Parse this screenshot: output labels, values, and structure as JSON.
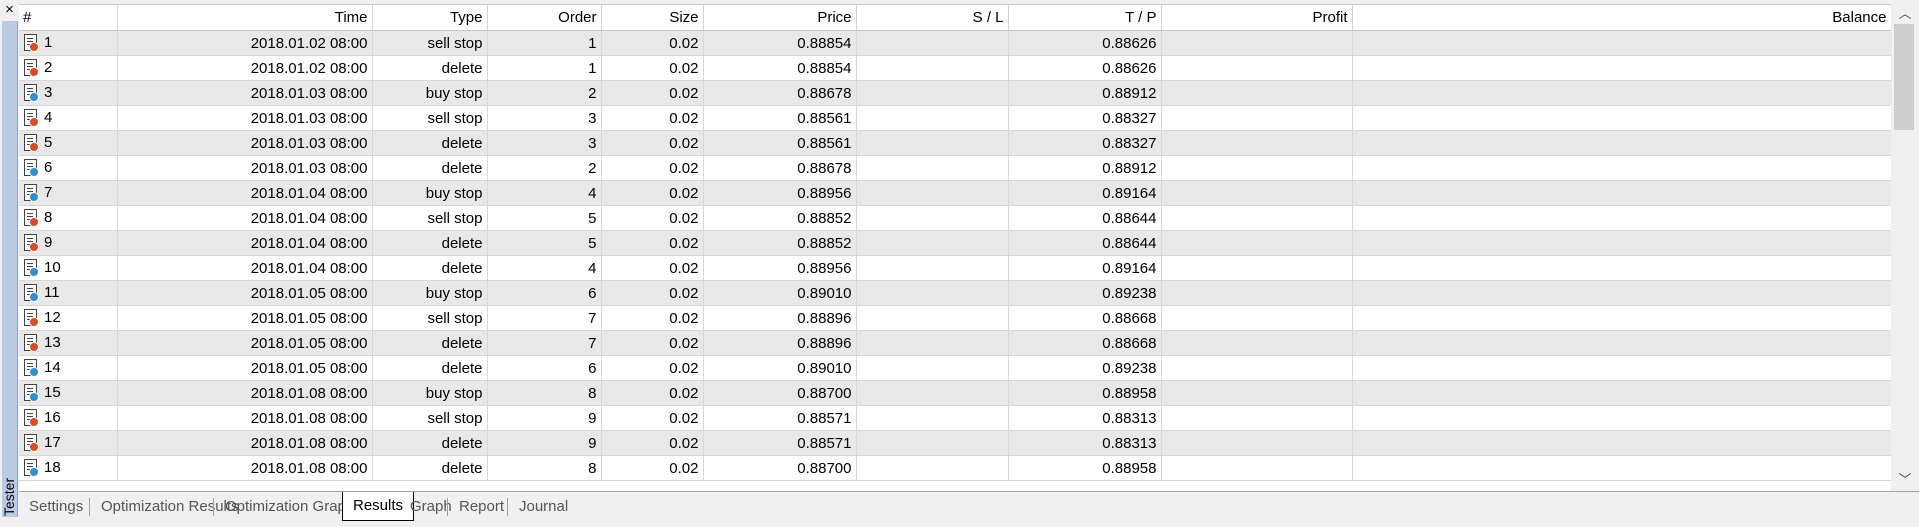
{
  "panel": {
    "side_label": "Tester",
    "close_label": "×"
  },
  "columns": [
    "#",
    "Time",
    "Type",
    "Order",
    "Size",
    "Price",
    "S / L",
    "T / P",
    "Profit",
    "Balance"
  ],
  "rows": [
    {
      "id": "1",
      "time": "2018.01.02 08:00",
      "type": "sell stop",
      "order": "1",
      "size": "0.02",
      "price": "0.88854",
      "sl": "",
      "tp": "0.88626",
      "profit": "",
      "balance": "",
      "dot": "sell"
    },
    {
      "id": "2",
      "time": "2018.01.02 08:00",
      "type": "delete",
      "order": "1",
      "size": "0.02",
      "price": "0.88854",
      "sl": "",
      "tp": "0.88626",
      "profit": "",
      "balance": "",
      "dot": "sell"
    },
    {
      "id": "3",
      "time": "2018.01.03 08:00",
      "type": "buy stop",
      "order": "2",
      "size": "0.02",
      "price": "0.88678",
      "sl": "",
      "tp": "0.88912",
      "profit": "",
      "balance": "",
      "dot": "buy"
    },
    {
      "id": "4",
      "time": "2018.01.03 08:00",
      "type": "sell stop",
      "order": "3",
      "size": "0.02",
      "price": "0.88561",
      "sl": "",
      "tp": "0.88327",
      "profit": "",
      "balance": "",
      "dot": "sell"
    },
    {
      "id": "5",
      "time": "2018.01.03 08:00",
      "type": "delete",
      "order": "3",
      "size": "0.02",
      "price": "0.88561",
      "sl": "",
      "tp": "0.88327",
      "profit": "",
      "balance": "",
      "dot": "sell"
    },
    {
      "id": "6",
      "time": "2018.01.03 08:00",
      "type": "delete",
      "order": "2",
      "size": "0.02",
      "price": "0.88678",
      "sl": "",
      "tp": "0.88912",
      "profit": "",
      "balance": "",
      "dot": "buy"
    },
    {
      "id": "7",
      "time": "2018.01.04 08:00",
      "type": "buy stop",
      "order": "4",
      "size": "0.02",
      "price": "0.88956",
      "sl": "",
      "tp": "0.89164",
      "profit": "",
      "balance": "",
      "dot": "buy"
    },
    {
      "id": "8",
      "time": "2018.01.04 08:00",
      "type": "sell stop",
      "order": "5",
      "size": "0.02",
      "price": "0.88852",
      "sl": "",
      "tp": "0.88644",
      "profit": "",
      "balance": "",
      "dot": "sell"
    },
    {
      "id": "9",
      "time": "2018.01.04 08:00",
      "type": "delete",
      "order": "5",
      "size": "0.02",
      "price": "0.88852",
      "sl": "",
      "tp": "0.88644",
      "profit": "",
      "balance": "",
      "dot": "sell"
    },
    {
      "id": "10",
      "time": "2018.01.04 08:00",
      "type": "delete",
      "order": "4",
      "size": "0.02",
      "price": "0.88956",
      "sl": "",
      "tp": "0.89164",
      "profit": "",
      "balance": "",
      "dot": "buy"
    },
    {
      "id": "11",
      "time": "2018.01.05 08:00",
      "type": "buy stop",
      "order": "6",
      "size": "0.02",
      "price": "0.89010",
      "sl": "",
      "tp": "0.89238",
      "profit": "",
      "balance": "",
      "dot": "buy"
    },
    {
      "id": "12",
      "time": "2018.01.05 08:00",
      "type": "sell stop",
      "order": "7",
      "size": "0.02",
      "price": "0.88896",
      "sl": "",
      "tp": "0.88668",
      "profit": "",
      "balance": "",
      "dot": "sell"
    },
    {
      "id": "13",
      "time": "2018.01.05 08:00",
      "type": "delete",
      "order": "7",
      "size": "0.02",
      "price": "0.88896",
      "sl": "",
      "tp": "0.88668",
      "profit": "",
      "balance": "",
      "dot": "sell"
    },
    {
      "id": "14",
      "time": "2018.01.05 08:00",
      "type": "delete",
      "order": "6",
      "size": "0.02",
      "price": "0.89010",
      "sl": "",
      "tp": "0.89238",
      "profit": "",
      "balance": "",
      "dot": "buy"
    },
    {
      "id": "15",
      "time": "2018.01.08 08:00",
      "type": "buy stop",
      "order": "8",
      "size": "0.02",
      "price": "0.88700",
      "sl": "",
      "tp": "0.88958",
      "profit": "",
      "balance": "",
      "dot": "buy"
    },
    {
      "id": "16",
      "time": "2018.01.08 08:00",
      "type": "sell stop",
      "order": "9",
      "size": "0.02",
      "price": "0.88571",
      "sl": "",
      "tp": "0.88313",
      "profit": "",
      "balance": "",
      "dot": "sell"
    },
    {
      "id": "17",
      "time": "2018.01.08 08:00",
      "type": "delete",
      "order": "9",
      "size": "0.02",
      "price": "0.88571",
      "sl": "",
      "tp": "0.88313",
      "profit": "",
      "balance": "",
      "dot": "sell"
    },
    {
      "id": "18",
      "time": "2018.01.08 08:00",
      "type": "delete",
      "order": "8",
      "size": "0.02",
      "price": "0.88700",
      "sl": "",
      "tp": "0.88958",
      "profit": "",
      "balance": "",
      "dot": "buy"
    }
  ],
  "tabs": [
    {
      "label": "Settings",
      "active": false
    },
    {
      "label": "Optimization Results",
      "active": false
    },
    {
      "label": "Optimization Graph",
      "active": false
    },
    {
      "label": "Results",
      "active": true
    },
    {
      "label": "Graph",
      "active": false
    },
    {
      "label": "Report",
      "active": false
    },
    {
      "label": "Journal",
      "active": false
    }
  ],
  "icons": {
    "row_icon": "order-document-icon",
    "sell_dot_color": "#e2491c",
    "buy_dot_color": "#2a8fd8",
    "scroll_up": "chevron-up-icon",
    "scroll_down": "chevron-down-icon"
  }
}
